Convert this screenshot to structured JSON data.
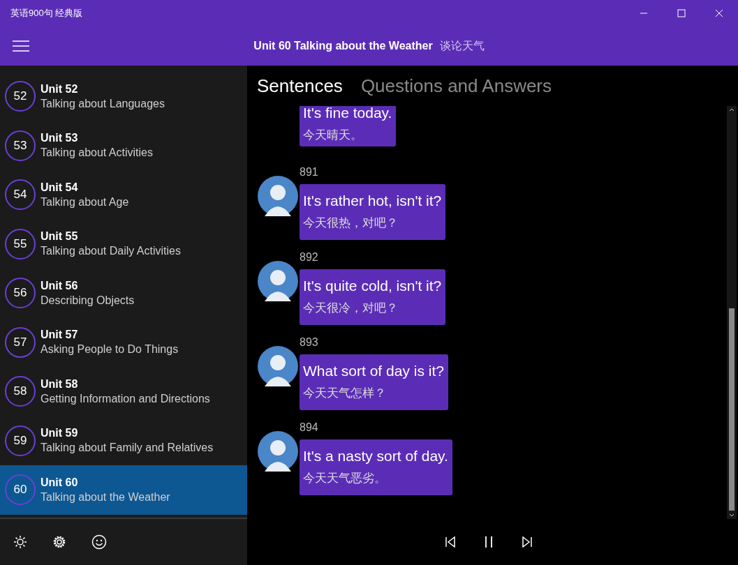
{
  "window": {
    "title": "英语900句 经典版"
  },
  "header": {
    "title": "Unit 60 Talking about the Weather",
    "subtitle": "谈论天气"
  },
  "sidebar": {
    "items": [
      {
        "number": "52",
        "unit": "Unit 52",
        "topic": "Talking about Languages",
        "selected": false
      },
      {
        "number": "53",
        "unit": "Unit 53",
        "topic": "Talking about Activities",
        "selected": false
      },
      {
        "number": "54",
        "unit": "Unit 54",
        "topic": "Talking about Age",
        "selected": false
      },
      {
        "number": "55",
        "unit": "Unit 55",
        "topic": "Talking about Daily Activities",
        "selected": false
      },
      {
        "number": "56",
        "unit": "Unit 56",
        "topic": "Describing Objects",
        "selected": false
      },
      {
        "number": "57",
        "unit": "Unit 57",
        "topic": "Asking People to Do Things",
        "selected": false
      },
      {
        "number": "58",
        "unit": "Unit 58",
        "topic": "Getting Information and Directions",
        "selected": false
      },
      {
        "number": "59",
        "unit": "Unit 59",
        "topic": "Talking about Family and Relatives",
        "selected": false
      },
      {
        "number": "60",
        "unit": "Unit 60",
        "topic": "Talking about the Weather",
        "selected": true
      }
    ]
  },
  "tabs": [
    {
      "label": "Sentences",
      "selected": true
    },
    {
      "label": "Questions and Answers",
      "selected": false
    }
  ],
  "messages": [
    {
      "english": "It's fine today.",
      "chinese": "今天晴天。"
    },
    {
      "number": "891",
      "english": "It's rather hot, isn't it?",
      "chinese": "今天很热，对吧？"
    },
    {
      "number": "892",
      "english": "It's quite cold, isn't it?",
      "chinese": "今天很冷，对吧？"
    },
    {
      "number": "893",
      "english": "What sort of day is it?",
      "chinese": "今天天气怎样？"
    },
    {
      "number": "894",
      "english": "It's a nasty sort of day.",
      "chinese": "今天天气恶劣。"
    }
  ]
}
